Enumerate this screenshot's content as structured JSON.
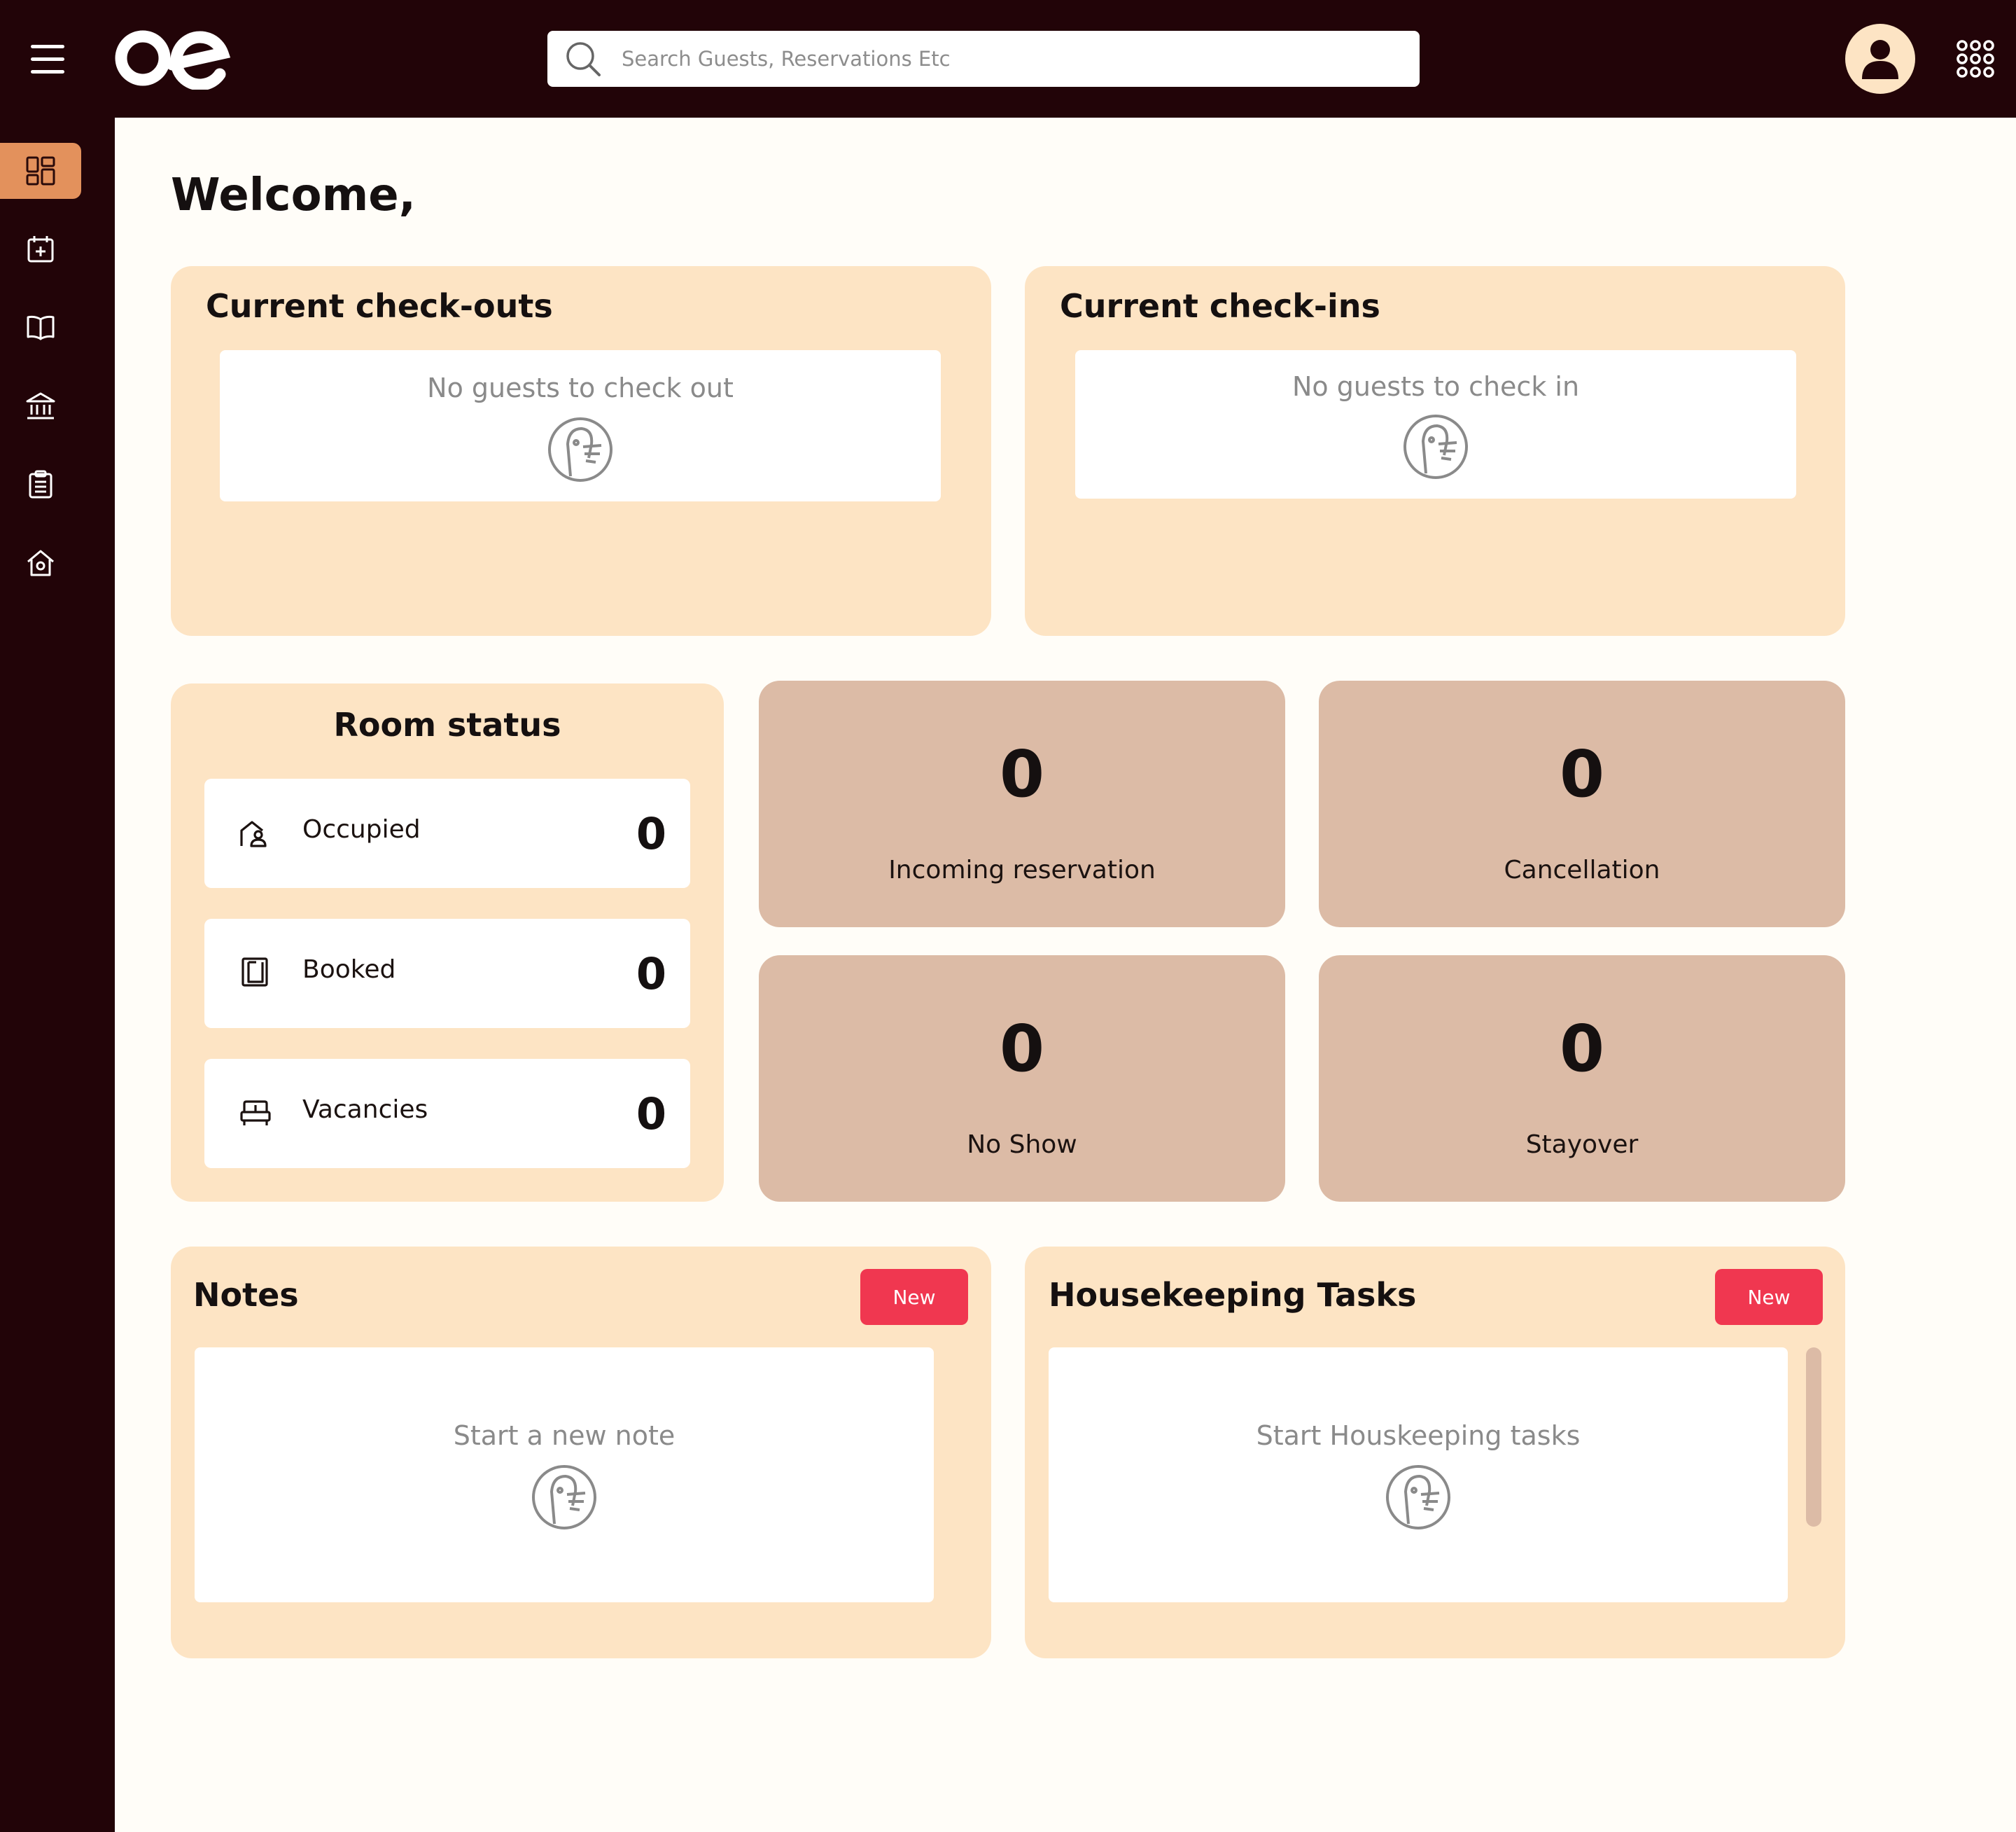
{
  "header": {
    "search_placeholder": "Search Guests, Reservations Etc",
    "logo_icon": "oe-logo",
    "menu_icon": "hamburger-icon",
    "profile_icon": "user-avatar-icon",
    "apps_icon": "apps-grid-icon"
  },
  "sidebar": {
    "items": [
      {
        "icon": "dashboard-icon",
        "active": true
      },
      {
        "icon": "calendar-add-icon",
        "active": false
      },
      {
        "icon": "book-icon",
        "active": false
      },
      {
        "icon": "bank-icon",
        "active": false
      },
      {
        "icon": "clipboard-icon",
        "active": false
      },
      {
        "icon": "house-settings-icon",
        "active": false
      }
    ]
  },
  "main": {
    "welcome": "Welcome,",
    "checkouts": {
      "title": "Current check-outs",
      "empty": "No guests to check out"
    },
    "checkins": {
      "title": "Current check-ins",
      "empty": "No guests to check in"
    },
    "room_status": {
      "title": "Room status",
      "rows": [
        {
          "label": "Occupied",
          "value": "0",
          "icon": "occupied-house-icon"
        },
        {
          "label": "Booked",
          "value": "0",
          "icon": "booked-door-icon"
        },
        {
          "label": "Vacancies",
          "value": "0",
          "icon": "bed-icon"
        }
      ]
    },
    "stats": [
      {
        "value": "0",
        "label": "Incoming reservation"
      },
      {
        "value": "0",
        "label": "Cancellation"
      },
      {
        "value": "0",
        "label": "No Show"
      },
      {
        "value": "0",
        "label": "Stayover"
      }
    ],
    "notes": {
      "title": "Notes",
      "new_label": "New",
      "empty": "Start a new note"
    },
    "housekeeping": {
      "title": "Housekeeping Tasks",
      "new_label": "New",
      "empty": "Start Houskeeping tasks"
    }
  },
  "colors": {
    "topbar": "#220408",
    "accent": "#e3915c",
    "card": "#fde4c4",
    "stat_card": "#dcbba6",
    "new_button": "#f03750"
  }
}
